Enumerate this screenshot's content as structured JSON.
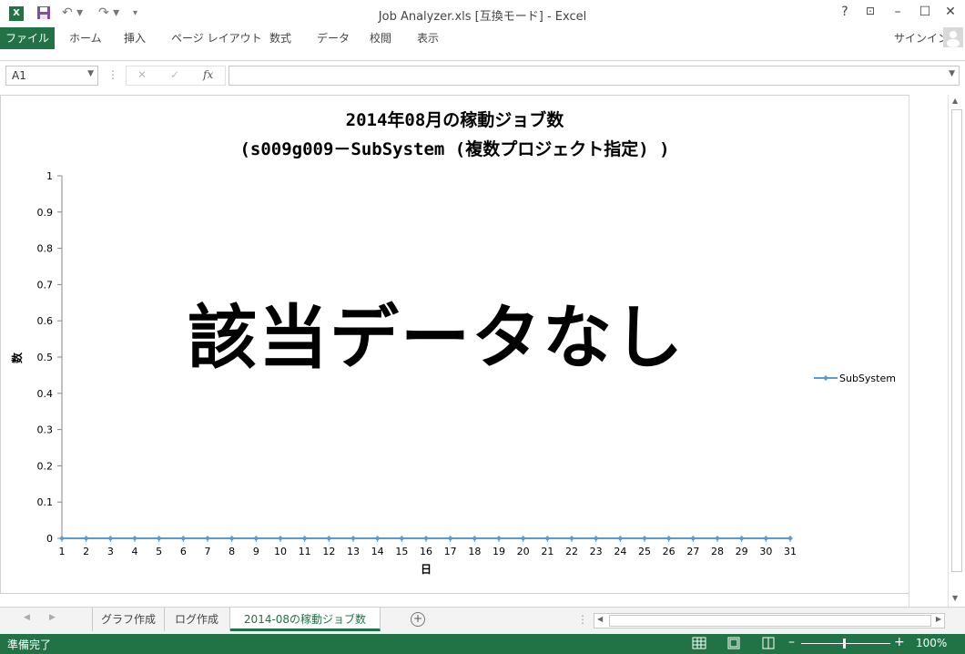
{
  "window": {
    "title": "Job Analyzer.xls  [互換モード] - Excel",
    "help": "?",
    "signin": "サインイン"
  },
  "ribbon": {
    "tabs": [
      "ファイル",
      "ホーム",
      "挿入",
      "ページ レイアウト",
      "数式",
      "データ",
      "校閲",
      "表示"
    ]
  },
  "formula_bar": {
    "name_box": "A1",
    "fx": "fx",
    "formula": ""
  },
  "chart_data": {
    "type": "line",
    "title_line1": "2014年08月の稼動ジョブ数",
    "title_line2": "(s009g009－SubSystem (複数プロジェクト指定) )",
    "xlabel": "日",
    "ylabel": "数",
    "categories": [
      "1",
      "2",
      "3",
      "4",
      "5",
      "6",
      "7",
      "8",
      "9",
      "10",
      "11",
      "12",
      "13",
      "14",
      "15",
      "16",
      "17",
      "18",
      "19",
      "20",
      "21",
      "22",
      "23",
      "24",
      "25",
      "26",
      "27",
      "28",
      "29",
      "30",
      "31"
    ],
    "y_ticks": [
      "0",
      "0.1",
      "0.2",
      "0.3",
      "0.4",
      "0.5",
      "0.6",
      "0.7",
      "0.8",
      "0.9",
      "1"
    ],
    "ylim": [
      0,
      1
    ],
    "series": [
      {
        "name": "SubSystem",
        "color": "#5b9bd5",
        "values": [
          0,
          0,
          0,
          0,
          0,
          0,
          0,
          0,
          0,
          0,
          0,
          0,
          0,
          0,
          0,
          0,
          0,
          0,
          0,
          0,
          0,
          0,
          0,
          0,
          0,
          0,
          0,
          0,
          0,
          0,
          0
        ]
      }
    ],
    "legend_position": "right",
    "overlay_text": "該当データなし"
  },
  "sheets": {
    "tabs": [
      "グラフ作成",
      "ログ作成",
      "2014-08の稼動ジョブ数"
    ],
    "active": 2
  },
  "status": {
    "text": "準備完了",
    "zoom": "100%"
  },
  "colors": {
    "accent": "#217346"
  }
}
